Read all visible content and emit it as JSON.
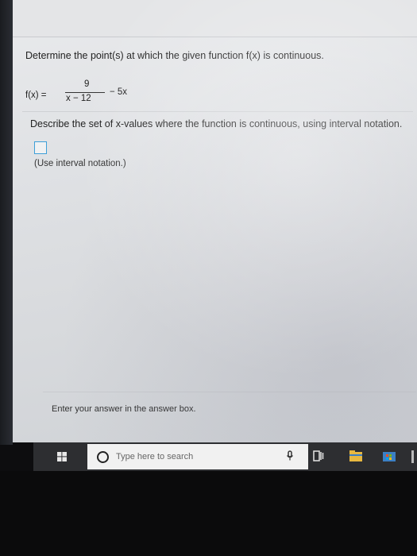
{
  "question": {
    "prompt": "Determine the point(s) at which the given function f(x) is continuous.",
    "formula": {
      "lhs": "f(x) =",
      "numerator": "9",
      "denominator": "x − 12",
      "tail": "− 5x"
    },
    "describe": "Describe the set of x-values where the function is continuous, using interval notation.",
    "answer_value": "",
    "hint": "(Use interval notation.)"
  },
  "footer": {
    "instruction": "Enter your answer in the answer box."
  },
  "taskbar": {
    "search_placeholder": "Type here to search",
    "icons": [
      "windows-logo",
      "cortana-circle",
      "microphone",
      "task-view",
      "file-explorer",
      "store"
    ]
  },
  "colors": {
    "answer_box_border": "#3d9fd8",
    "taskbar_bg": "#2d2e31"
  }
}
